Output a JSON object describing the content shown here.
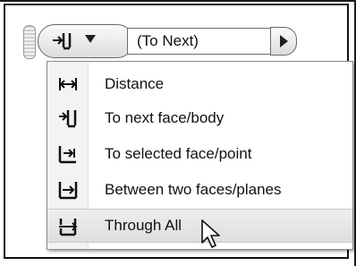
{
  "toolbar": {
    "extent_icon": "to-next-icon",
    "dropdown_icon": "chevron-down-icon",
    "value_field": "(To Next)",
    "next_icon": "triangle-right-icon"
  },
  "menu": {
    "items": [
      {
        "label": "Distance",
        "icon": "distance-icon"
      },
      {
        "label": "To next face/body",
        "icon": "to-next-icon"
      },
      {
        "label": "To selected face/point",
        "icon": "to-selected-icon"
      },
      {
        "label": "Between two faces/planes",
        "icon": "between-icon"
      },
      {
        "label": "Through All",
        "icon": "through-all-icon",
        "hovered": true
      }
    ]
  },
  "cursor": "arrow-cursor-icon"
}
